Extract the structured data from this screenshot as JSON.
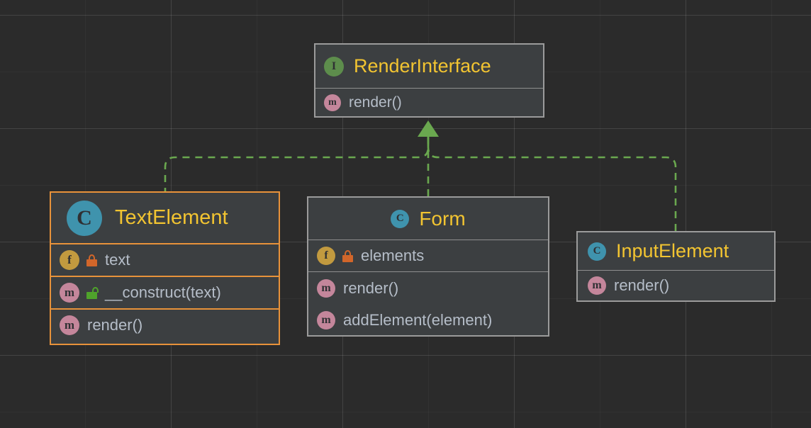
{
  "diagram": {
    "kind": "uml-class-diagram",
    "canvas_background": "#2b2b2b",
    "grid": true,
    "relationship_label": "realization",
    "edge_color": "#6aa84f"
  },
  "nodes": [
    {
      "id": "render-interface",
      "name": "RenderInterface",
      "stereotype_icon": "interface-icon",
      "stereotype_letter": "I",
      "selected": false,
      "title_align": "left",
      "sections": [
        {
          "kind": "methods",
          "members": [
            {
              "icon": "method-icon",
              "icon_letter": "m",
              "visibility": null,
              "label": "render()"
            }
          ]
        }
      ]
    },
    {
      "id": "text-element",
      "name": "TextElement",
      "stereotype_icon": "class-icon",
      "stereotype_letter": "C",
      "selected": true,
      "title_align": "left",
      "sections": [
        {
          "kind": "fields",
          "members": [
            {
              "icon": "field-icon",
              "icon_letter": "f",
              "visibility": "private",
              "label": "text"
            }
          ]
        },
        {
          "kind": "methods",
          "members": [
            {
              "icon": "method-icon",
              "icon_letter": "m",
              "visibility": "public",
              "label": "__construct(text)"
            }
          ]
        },
        {
          "kind": "methods",
          "members": [
            {
              "icon": "method-icon",
              "icon_letter": "m",
              "visibility": null,
              "label": "render()"
            }
          ]
        }
      ]
    },
    {
      "id": "form",
      "name": "Form",
      "stereotype_icon": "class-icon",
      "stereotype_letter": "C",
      "selected": false,
      "title_align": "center",
      "sections": [
        {
          "kind": "fields",
          "members": [
            {
              "icon": "field-icon",
              "icon_letter": "f",
              "visibility": "private",
              "label": "elements"
            }
          ]
        },
        {
          "kind": "methods",
          "members": [
            {
              "icon": "method-icon",
              "icon_letter": "m",
              "visibility": null,
              "label": "render()"
            },
            {
              "icon": "method-icon",
              "icon_letter": "m",
              "visibility": null,
              "label": "addElement(element)"
            }
          ]
        }
      ]
    },
    {
      "id": "input-element",
      "name": "InputElement",
      "stereotype_icon": "class-icon",
      "stereotype_letter": "C",
      "selected": false,
      "title_align": "left",
      "sections": [
        {
          "kind": "methods",
          "members": [
            {
              "icon": "method-icon",
              "icon_letter": "m",
              "visibility": null,
              "label": "render()"
            }
          ]
        }
      ]
    }
  ],
  "edges": [
    {
      "from": "text-element",
      "to": "render-interface",
      "style": "dashed",
      "arrow": "closed-triangle"
    },
    {
      "from": "form",
      "to": "render-interface",
      "style": "dashed",
      "arrow": "closed-triangle"
    },
    {
      "from": "input-element",
      "to": "render-interface",
      "style": "dashed",
      "arrow": "closed-triangle"
    }
  ],
  "colors": {
    "class_icon": "#3f93ad",
    "interface_icon": "#5d8d4c",
    "field_icon": "#c29a3f",
    "method_icon": "#c4869b",
    "title_text": "#f2c431",
    "member_text": "#b5bdc8",
    "node_fill": "#3c3f41",
    "node_border": "#9b9b9b",
    "selected_border": "#e8923a",
    "edge": "#6aa84f",
    "lock_private": "#d2662a",
    "lock_public": "#4fa32b"
  }
}
